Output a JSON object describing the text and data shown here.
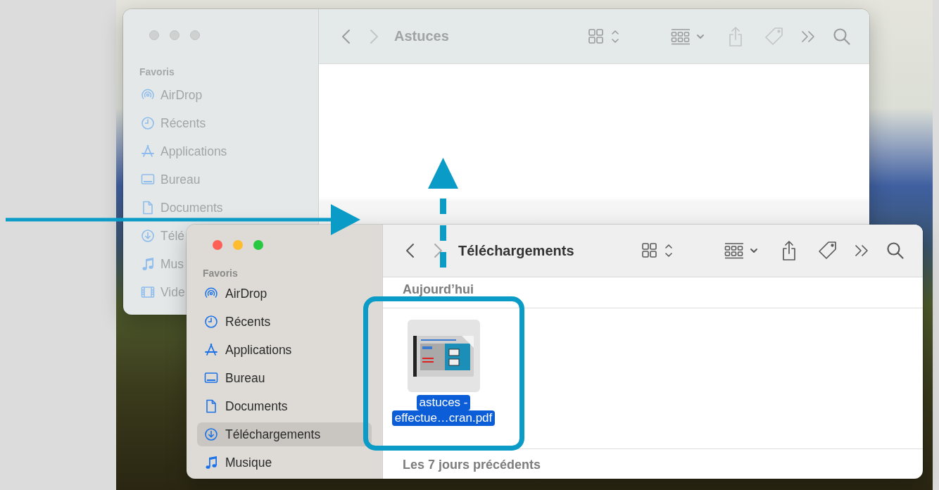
{
  "back_window": {
    "active": false,
    "title": "Astuces",
    "forward_enabled": false,
    "file_actions_enabled": false,
    "sidebar": {
      "heading": "Favoris",
      "items": [
        {
          "kind": "airdrop",
          "label": "AirDrop",
          "selected": false
        },
        {
          "kind": "recent",
          "label": "Récents",
          "selected": false
        },
        {
          "kind": "apps",
          "label": "Applications",
          "selected": false
        },
        {
          "kind": "desktop",
          "label": "Bureau",
          "selected": false
        },
        {
          "kind": "document",
          "label": "Documents",
          "selected": false
        },
        {
          "kind": "download",
          "label": "Télé",
          "selected": false
        },
        {
          "kind": "music",
          "label": "Mus",
          "selected": false
        },
        {
          "kind": "film",
          "label": "Vide",
          "selected": false
        }
      ]
    }
  },
  "front_window": {
    "active": true,
    "title": "Téléchargements",
    "forward_enabled": false,
    "file_actions_enabled": true,
    "sidebar": {
      "heading": "Favoris",
      "items": [
        {
          "kind": "airdrop",
          "label": "AirDrop",
          "selected": false
        },
        {
          "kind": "recent",
          "label": "Récents",
          "selected": false
        },
        {
          "kind": "apps",
          "label": "Applications",
          "selected": false
        },
        {
          "kind": "desktop",
          "label": "Bureau",
          "selected": false
        },
        {
          "kind": "document",
          "label": "Documents",
          "selected": false
        },
        {
          "kind": "download",
          "label": "Téléchargements",
          "selected": true
        },
        {
          "kind": "music",
          "label": "Musique",
          "selected": false
        }
      ]
    },
    "sections": [
      {
        "label": "Aujourd’hui",
        "files": [
          {
            "name_lines": [
              "astuces -",
              "effectue…cran.pdf"
            ],
            "selected": true
          }
        ]
      },
      {
        "label": "Les 7 jours précédents"
      }
    ]
  }
}
